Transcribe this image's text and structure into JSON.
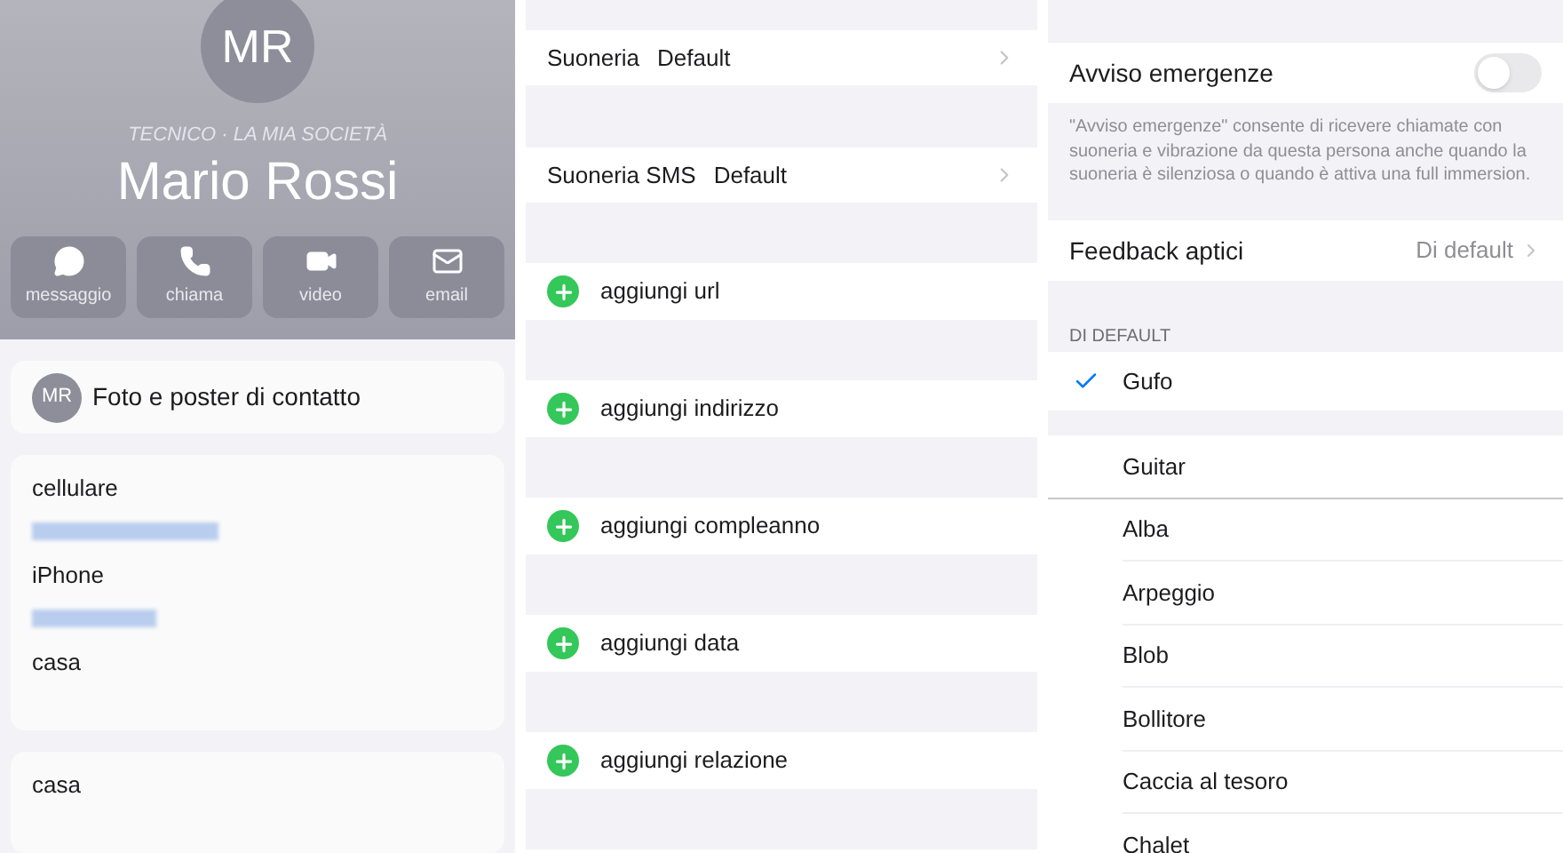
{
  "contact": {
    "avatar": "MR",
    "subtitle": "TECNICO · LA MIA SOCIETÀ",
    "name": "Mario Rossi",
    "actions": [
      {
        "kind": "message",
        "label": "messaggio"
      },
      {
        "kind": "phone",
        "label": "chiama"
      },
      {
        "kind": "video",
        "label": "video"
      },
      {
        "kind": "mail",
        "label": "email"
      }
    ],
    "poster": {
      "avatar": "MR",
      "label": "Foto e poster di contatto"
    },
    "phones": [
      {
        "label": "cellulare",
        "redacted": true
      },
      {
        "label": "iPhone",
        "redacted": true
      },
      {
        "label": "casa",
        "redacted": false
      }
    ],
    "addresses": [
      {
        "label": "casa"
      }
    ]
  },
  "ringtones": [
    {
      "label": "Suoneria",
      "value": "Default"
    },
    {
      "label": "Suoneria SMS",
      "value": "Default"
    }
  ],
  "add_items": [
    "aggiungi url",
    "aggiungi indirizzo",
    "aggiungi compleanno",
    "aggiungi data",
    "aggiungi relazione"
  ],
  "emergency": {
    "label": "Avviso emergenze",
    "on": false,
    "note": "\"Avviso emergenze\" consente di ricevere chiamate con suoneria e vibrazione da questa persona anche quando la suoneria è silenziosa o quando è attiva una full immersion."
  },
  "haptics": {
    "label": "Feedback aptici",
    "value": "Di default"
  },
  "default_section": {
    "header": "DI DEFAULT",
    "items": [
      {
        "label": "Gufo",
        "selected": true
      }
    ]
  },
  "tone_list": [
    {
      "label": "Guitar",
      "selected": false
    },
    {
      "label": "Alba",
      "selected": false
    },
    {
      "label": "Arpeggio",
      "selected": false
    },
    {
      "label": "Blob",
      "selected": false
    },
    {
      "label": "Bollitore",
      "selected": false
    },
    {
      "label": "Caccia al tesoro",
      "selected": false
    },
    {
      "label": "Chalet",
      "selected": false
    }
  ]
}
